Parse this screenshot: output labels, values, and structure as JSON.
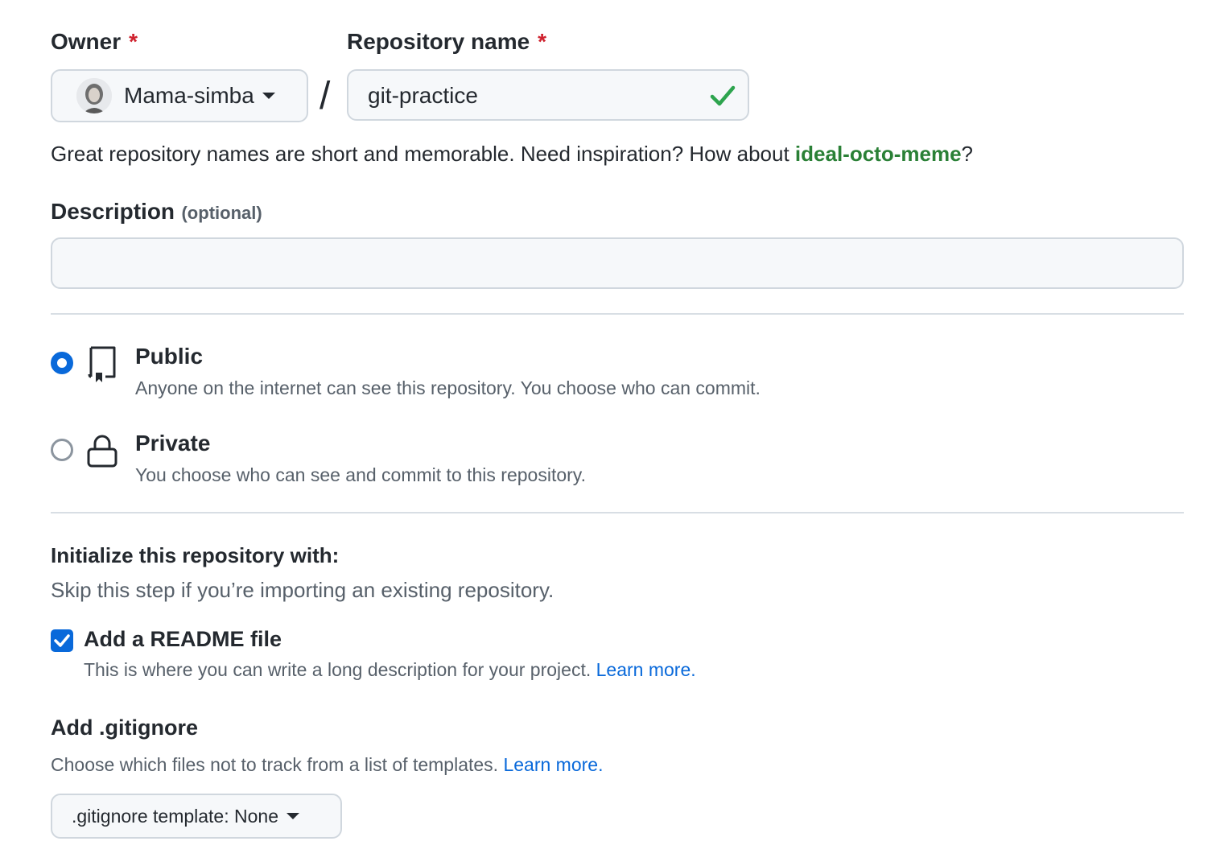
{
  "owner": {
    "label": "Owner",
    "required_mark": "*",
    "selected": "Mama-simba"
  },
  "separator": "/",
  "repo_name": {
    "label": "Repository name",
    "required_mark": "*",
    "value": "git-practice",
    "status_icon": "check-icon",
    "status_color": "#2da44e"
  },
  "name_hint": {
    "text": "Great repository names are short and memorable. Need inspiration? How about ",
    "suggestion": "ideal-octo-meme",
    "suffix": "?"
  },
  "description": {
    "label": "Description",
    "optional": "(optional)",
    "value": "",
    "placeholder": ""
  },
  "visibility": {
    "options": [
      {
        "title": "Public",
        "desc": "Anyone on the internet can see this repository. You choose who can commit.",
        "icon": "repo-icon",
        "selected": true
      },
      {
        "title": "Private",
        "desc": "You choose who can see and commit to this repository.",
        "icon": "lock-icon",
        "selected": false
      }
    ]
  },
  "init": {
    "heading": "Initialize this repository with:",
    "subtext": "Skip this step if you’re importing an existing repository.",
    "readme": {
      "label": "Add a README file",
      "desc": "This is where you can write a long description for your project.",
      "link": "Learn more.",
      "checked": true
    }
  },
  "gitignore": {
    "heading": "Add .gitignore",
    "desc": "Choose which files not to track from a list of templates.",
    "link": "Learn more.",
    "select_label": ".gitignore template: None"
  },
  "colors": {
    "accent": "#0969da",
    "success": "#2da44e",
    "required": "#cf222e",
    "suggestion": "#2a8036"
  }
}
